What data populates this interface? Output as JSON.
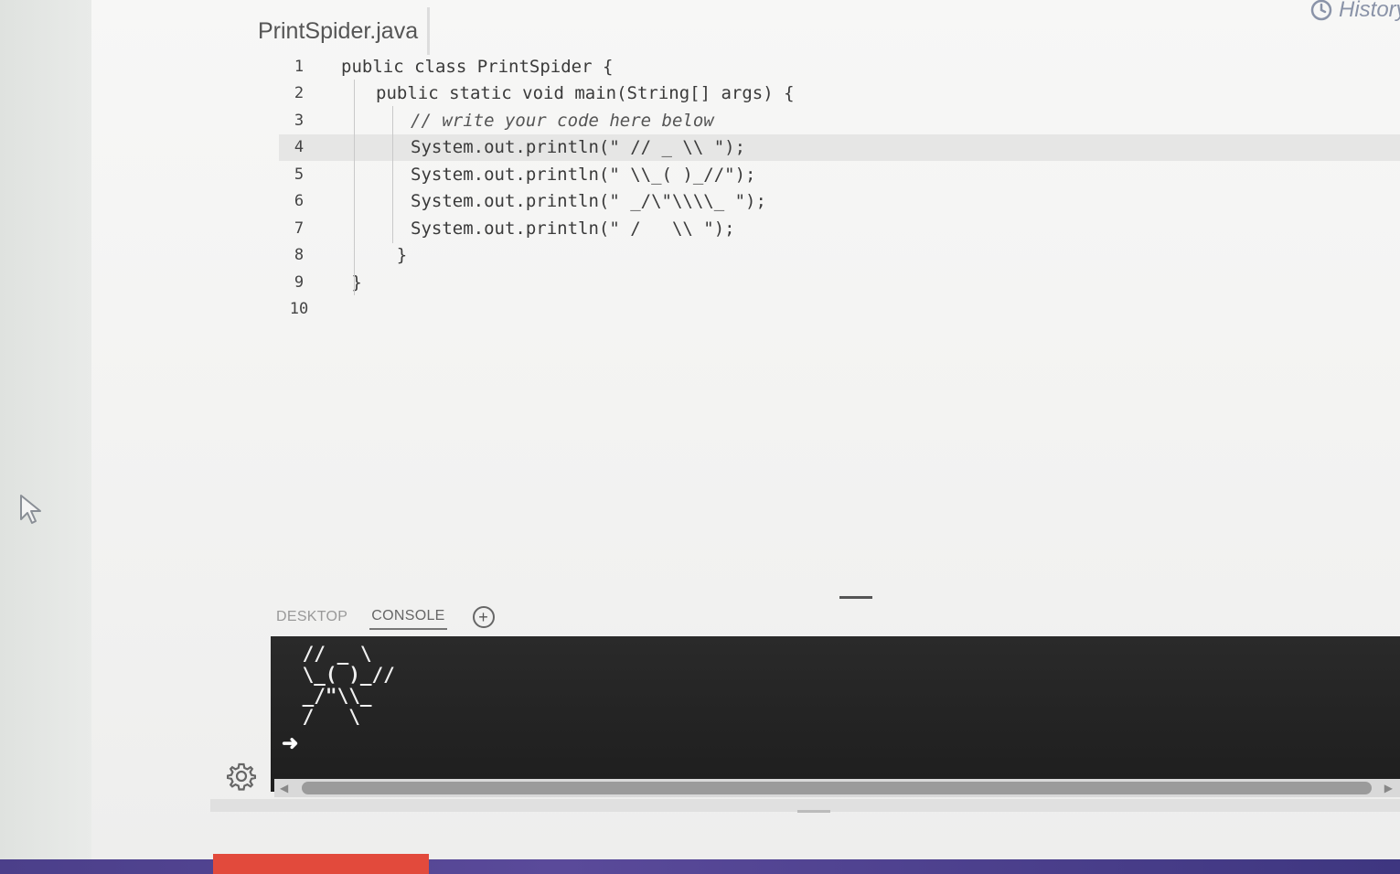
{
  "editor": {
    "filename": "PrintSpider.java",
    "lines": [
      {
        "number": "1",
        "text": "public class PrintSpider {",
        "indent": 0
      },
      {
        "number": "2",
        "text": "public static void main(String[] args) {",
        "indent": 1
      },
      {
        "number": "3",
        "text": "// write your code here below",
        "indent": 2,
        "comment": true
      },
      {
        "number": "4",
        "text": "System.out.println(\" // _ \\\\ \");",
        "indent": 2,
        "active": true
      },
      {
        "number": "5",
        "text": "System.out.println(\" \\\\_( )_//\");",
        "indent": 2
      },
      {
        "number": "6",
        "text": "System.out.println(\" _/\\\"\\\\\\\\_ \");",
        "indent": 2
      },
      {
        "number": "7",
        "text": "System.out.println(\" /   \\\\ \");",
        "indent": 2
      },
      {
        "number": "8",
        "text": "}",
        "indent": 1.6
      },
      {
        "number": "9",
        "text": "}",
        "indent": 0.3
      },
      {
        "number": "10",
        "text": "",
        "indent": 0
      }
    ]
  },
  "header": {
    "history_label": "History"
  },
  "bottom_panel": {
    "tabs": [
      {
        "label": "DESKTOP",
        "active": false
      },
      {
        "label": "CONSOLE",
        "active": true
      }
    ],
    "add_tab_symbol": "+"
  },
  "console": {
    "output": " // _ \\\n \\_( )_//\n _/\"\\\\_\n /   \\",
    "prompt": "➜"
  },
  "icons": {
    "history": "history-clock-icon",
    "settings": "gear-icon",
    "add_tab": "plus-circle-icon",
    "cursor": "mouse-pointer-icon"
  }
}
